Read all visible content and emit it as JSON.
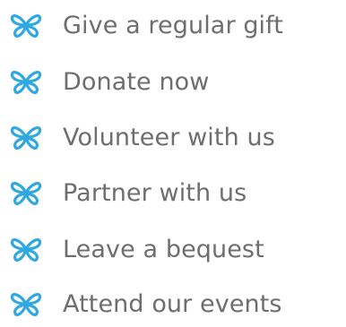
{
  "theme": {
    "text_color": "#6e6e6e",
    "icon_color": "#2fa8e0",
    "background": "#ffffff"
  },
  "menu": {
    "icon": "butterfly-icon",
    "items": [
      {
        "label": "Give a regular gift"
      },
      {
        "label": "Donate now"
      },
      {
        "label": "Volunteer with us"
      },
      {
        "label": "Partner with us"
      },
      {
        "label": "Leave a bequest"
      },
      {
        "label": "Attend our events"
      }
    ]
  }
}
